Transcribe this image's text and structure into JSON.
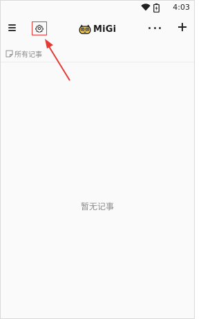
{
  "status_bar": {
    "time": "4:03",
    "icons": [
      "wifi-icon",
      "battery-icon"
    ]
  },
  "app_bar": {
    "menu_icon": "hamburger-menu-icon",
    "settings_icon": "gear-icon",
    "logo_text": "MiGi",
    "more_icon": "more-horizontal-icon",
    "add_icon": "plus-icon"
  },
  "filter": {
    "label": "所有记事",
    "icon": "note-icon"
  },
  "empty_state": {
    "text": "暂无记事"
  },
  "colors": {
    "annotation_red": "#e53935",
    "background": "#fafafa",
    "muted_text": "#8c8c8c"
  }
}
